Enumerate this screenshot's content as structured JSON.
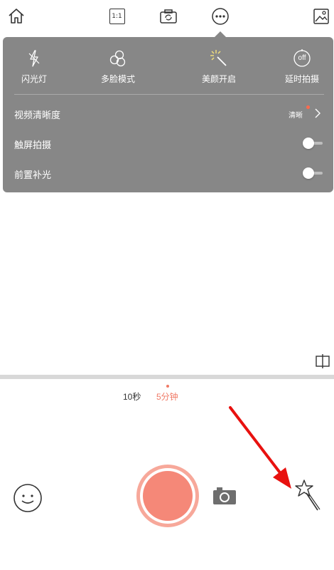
{
  "topbar": {
    "ratio_label": "1:1"
  },
  "menu": {
    "options": [
      {
        "label": "闪光灯",
        "icon": "flash-off-icon"
      },
      {
        "label": "多脸模式",
        "icon": "multi-face-icon"
      },
      {
        "label": "美颜开启",
        "icon": "beauty-sparkle-icon"
      },
      {
        "label": "延时拍摄",
        "icon": "timer-off-icon"
      }
    ],
    "timer_badge": "off",
    "rows": {
      "video_quality": {
        "label": "视频清晰度",
        "value": "清晰"
      },
      "touch_capture": {
        "label": "触屏拍摄",
        "enabled": false
      },
      "front_fill_light": {
        "label": "前置补光",
        "enabled": false
      }
    }
  },
  "durations": {
    "items": [
      "10秒",
      "5分钟"
    ],
    "selected": "5分钟"
  },
  "colors": {
    "menu_bg": "#878787",
    "accent": "#f58878",
    "record_ring": "#f7a89a",
    "annotation_arrow": "#e8110f",
    "divider": "#d8d8d8"
  }
}
